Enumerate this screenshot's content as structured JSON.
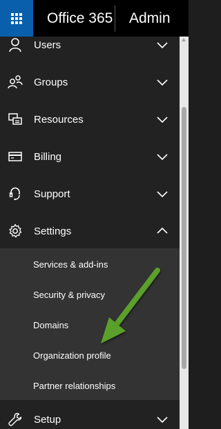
{
  "header": {
    "app_name": "Office 365",
    "section": "Admin"
  },
  "nav": {
    "items": [
      {
        "label": "Users",
        "icon": "user-icon",
        "expanded": false
      },
      {
        "label": "Groups",
        "icon": "groups-icon",
        "expanded": false
      },
      {
        "label": "Resources",
        "icon": "resources-icon",
        "expanded": false
      },
      {
        "label": "Billing",
        "icon": "billing-icon",
        "expanded": false
      },
      {
        "label": "Support",
        "icon": "support-headset-icon",
        "expanded": false
      },
      {
        "label": "Settings",
        "icon": "gear-icon",
        "expanded": true
      },
      {
        "label": "Setup",
        "icon": "wrench-icon",
        "expanded": false
      }
    ],
    "settings_submenu": [
      "Services & add-ins",
      "Security & privacy",
      "Domains",
      "Organization profile",
      "Partner relationships"
    ]
  },
  "colors": {
    "waffle_bg": "#0a5fad",
    "nav_bg": "#222222",
    "submenu_bg": "#333333",
    "annotation_arrow": "#5aa02c"
  }
}
